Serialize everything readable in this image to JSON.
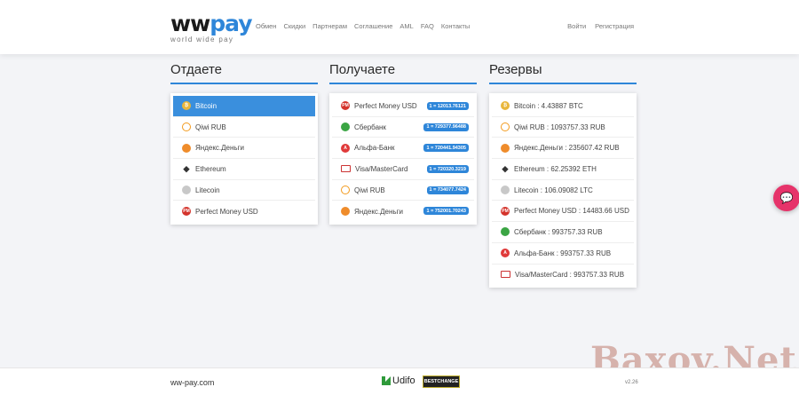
{
  "header": {
    "logo_main_a": "ww",
    "logo_main_b": "pay",
    "logo_sub": "world wide pay",
    "nav": [
      "Обмен",
      "Скидки",
      "Партнерам",
      "Соглашение",
      "AML",
      "FAQ",
      "Контакты"
    ],
    "login": "Войти",
    "register": "Регистрация"
  },
  "give": {
    "title": "Отдаете",
    "items": [
      {
        "label": "Bitcoin",
        "icon": "bitcoin-icon"
      },
      {
        "label": "Qiwi RUB",
        "icon": "qiwi-icon"
      },
      {
        "label": "Яндекс.Деньги",
        "icon": "yandex-money-icon"
      },
      {
        "label": "Ethereum",
        "icon": "ethereum-icon"
      },
      {
        "label": "Litecoin",
        "icon": "litecoin-icon"
      },
      {
        "label": "Perfect Money USD",
        "icon": "perfect-money-icon"
      }
    ]
  },
  "get": {
    "title": "Получаете",
    "items": [
      {
        "label": "Perfect Money USD",
        "rate": "1 = 12013.76121",
        "icon": "perfect-money-icon"
      },
      {
        "label": "Сбербанк",
        "rate": "1 = 729377.96488",
        "icon": "sberbank-icon"
      },
      {
        "label": "Альфа-Банк",
        "rate": "1 = 720441.94305",
        "icon": "alfa-bank-icon"
      },
      {
        "label": "Visa/MasterCard",
        "rate": "1 = 720320.3219",
        "icon": "visa-icon"
      },
      {
        "label": "Qiwi RUB",
        "rate": "1 = 734077.7424",
        "icon": "qiwi-icon"
      },
      {
        "label": "Яндекс.Деньги",
        "rate": "1 = 752001.70243",
        "icon": "yandex-money-icon"
      }
    ]
  },
  "reserves": {
    "title": "Резервы",
    "items": [
      {
        "label": "Bitcoin : 4.43887 BTC",
        "icon": "bitcoin-icon"
      },
      {
        "label": "Qiwi RUB : 1093757.33 RUB",
        "icon": "qiwi-icon"
      },
      {
        "label": "Яндекс.Деньги : 235607.42 RUB",
        "icon": "yandex-money-icon"
      },
      {
        "label": "Ethereum : 62.25392 ETH",
        "icon": "ethereum-icon"
      },
      {
        "label": "Litecoin : 106.09082 LTC",
        "icon": "litecoin-icon"
      },
      {
        "label": "Perfect Money USD : 14483.66 USD",
        "icon": "perfect-money-icon"
      },
      {
        "label": "Сбербанк : 993757.33 RUB",
        "icon": "sberbank-icon"
      },
      {
        "label": "Альфа-Банк : 993757.33 RUB",
        "icon": "alfa-bank-icon"
      },
      {
        "label": "Visa/MasterCard : 993757.33 RUB",
        "icon": "visa-icon"
      }
    ]
  },
  "footer": {
    "site": "ww-pay.com",
    "udifo": "Udifo",
    "bestchange": "BESTCHANGE",
    "version": "v2.26"
  },
  "watermark": "Baxov.Net",
  "colors": {
    "accent": "#2e86d9",
    "chat": "#e6336a"
  }
}
